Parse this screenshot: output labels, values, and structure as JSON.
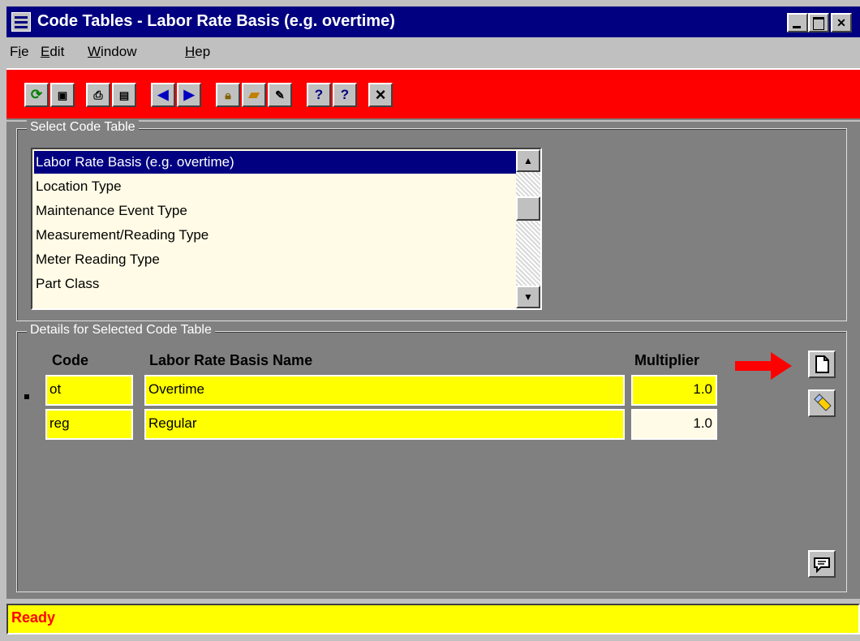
{
  "window": {
    "title": "Code Tables - Labor Rate Basis (e.g. overtime)",
    "minimize_icon": "minimize-icon",
    "maximize_icon": "maximize-icon",
    "close_icon": "close-icon"
  },
  "menu": {
    "file": {
      "pre": "F",
      "ul": "i",
      "post": "e"
    },
    "edit": {
      "pre": "",
      "ul": "E",
      "post": "dit"
    },
    "window": {
      "pre": "",
      "ul": "W",
      "post": "indow"
    },
    "help": {
      "pre": "",
      "ul": "H",
      "post": "ep"
    }
  },
  "toolbar": {
    "icons": [
      "refresh-icon",
      "save-icon",
      "print-icon",
      "print-preview-icon",
      "previous-record-icon",
      "next-record-icon",
      "lock-icon",
      "open-folder-icon",
      "edit-icon",
      "help-icon",
      "context-help-icon",
      "close-icon"
    ],
    "close_glyph": "×",
    "help_glyph": "?"
  },
  "select_code_table": {
    "title": "Select Code Table",
    "items": [
      {
        "label": "Labor Rate Basis (e.g. overtime)",
        "selected": true
      },
      {
        "label": "Location Type",
        "selected": false
      },
      {
        "label": "Maintenance Event Type",
        "selected": false
      },
      {
        "label": "Measurement/Reading Type",
        "selected": false
      },
      {
        "label": "Meter Reading Type",
        "selected": false
      },
      {
        "label": "Part Class",
        "selected": false
      }
    ],
    "scroll_up_glyph": "▲",
    "scroll_down_glyph": "▼"
  },
  "details": {
    "title": "Details for Selected Code Table",
    "columns": {
      "code": "Code",
      "name": "Labor Rate Basis Name",
      "multiplier": "Multiplier"
    },
    "rows": [
      {
        "code": "ot",
        "name": "Overtime",
        "multiplier": "1.0",
        "current": true
      },
      {
        "code": "reg",
        "name": "Regular",
        "multiplier": "1.0",
        "current": false
      }
    ],
    "buttons": [
      "new-record-icon",
      "eraser-icon",
      "comment-icon"
    ],
    "arrow_color": "#ff0000"
  },
  "status": {
    "text": "Ready",
    "color": "#ff0000",
    "background": "#ffff00"
  },
  "colors": {
    "toolbar_bg": "#ff0000",
    "field_bg": "#ffff00",
    "selection": "#000080"
  }
}
